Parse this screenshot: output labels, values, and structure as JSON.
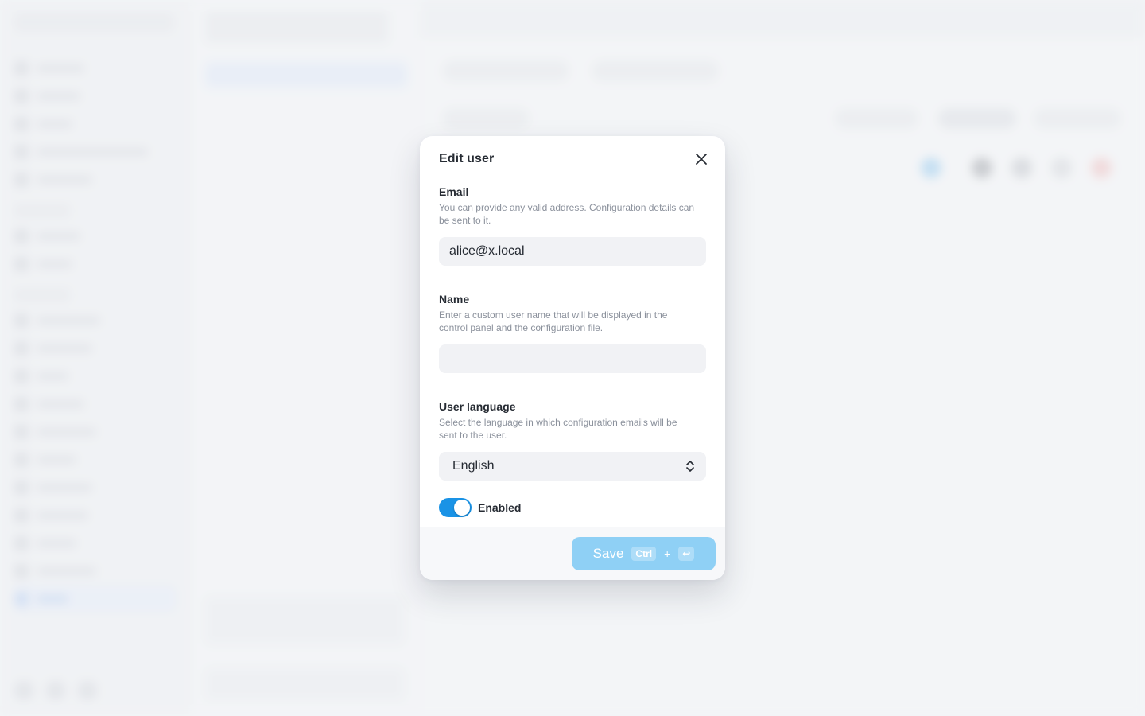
{
  "modal": {
    "title": "Edit user",
    "close_icon": "close-icon",
    "email": {
      "label": "Email",
      "help": "You can provide any valid address. Configuration details can be sent to it.",
      "value": "alice@x.local"
    },
    "name": {
      "label": "Name",
      "help": "Enter a custom user name that will be displayed in the control panel and the configuration file.",
      "value": ""
    },
    "language": {
      "label": "User language",
      "help": "Select the language in which configuration emails will be sent to the user.",
      "selected": "English",
      "icon": "chevron-up-down-icon"
    },
    "enabled": {
      "label": "Enabled",
      "checked": true
    },
    "save": {
      "label": "Save",
      "shortcut_key": "Ctrl",
      "shortcut_plus": "+",
      "shortcut_enter": "↩"
    }
  },
  "colors": {
    "accent": "#1a93e6",
    "save_button": "#8fd0f5",
    "input_bg": "#f1f2f5"
  }
}
